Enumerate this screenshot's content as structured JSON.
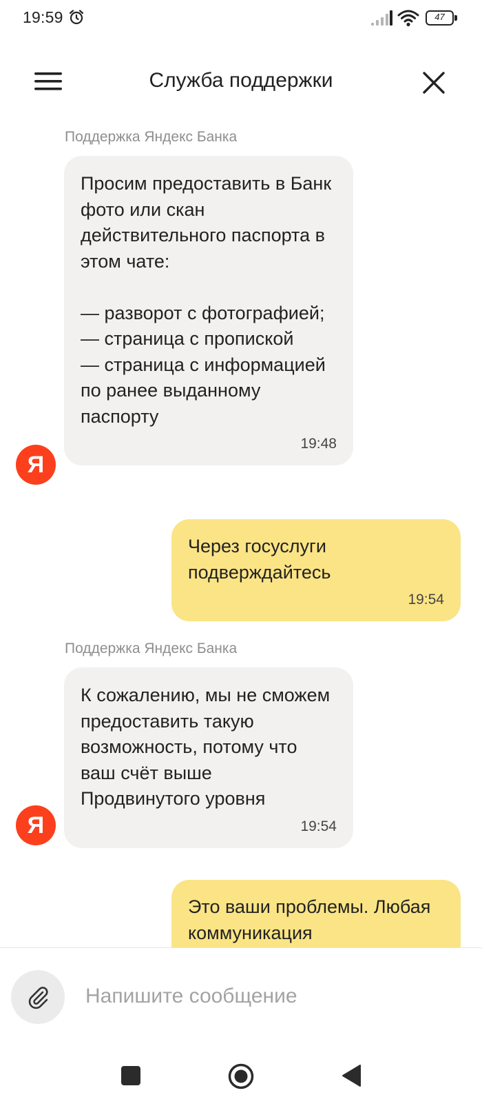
{
  "status_bar": {
    "time": "19:59",
    "battery_level": "47",
    "icons": [
      "alarm-icon",
      "signal-icon",
      "wifi-icon",
      "battery-icon"
    ]
  },
  "header": {
    "title": "Служба поддержки",
    "menu_icon": "hamburger-menu-icon",
    "close_icon": "close-icon"
  },
  "chat": {
    "messages": [
      {
        "direction": "incoming",
        "sender": "Поддержка Яндекс Банка",
        "avatar_letter": "Я",
        "text": "Просим предоставить в Банк фото или скан действительного паспорта в этом чате:\n\n— разворот с фотографией;\n— страница с пропиской\n— страница с информацией по ранее выданному паспорту",
        "time": "19:48"
      },
      {
        "direction": "outgoing",
        "text": "Через госуслуги подверждайтесь",
        "time": "19:54"
      },
      {
        "direction": "incoming",
        "sender": "Поддержка Яндекс Банка",
        "avatar_letter": "Я",
        "text": "К сожалению, мы не сможем предоставить такую возможность, потому что ваш счёт выше Продвинутого уровня",
        "time": "19:54"
      },
      {
        "direction": "outgoing",
        "text": "Это ваши проблемы. Любая коммуникация"
      }
    ]
  },
  "composer": {
    "placeholder": "Напишите сообщение",
    "value": "",
    "attach_icon": "paperclip-icon"
  },
  "nav_bar": {
    "icons": [
      "recents-square-icon",
      "home-circle-icon",
      "back-triangle-icon"
    ]
  },
  "colors": {
    "incoming_bubble": "#f2f1ef",
    "outgoing_bubble": "#fbe485",
    "avatar_brand": "#fc3f1d",
    "sender_label": "#8e8e8e",
    "placeholder": "#a3a3a3"
  }
}
